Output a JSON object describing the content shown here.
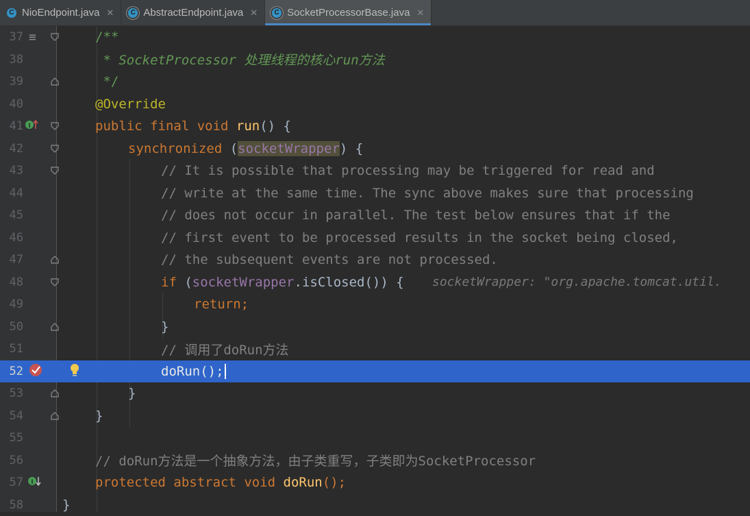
{
  "tabs": [
    {
      "label": "NioEndpoint.java",
      "icon": "class-icon",
      "active": false
    },
    {
      "label": "AbstractEndpoint.java",
      "icon": "abstract-class-icon",
      "active": false
    },
    {
      "label": "SocketProcessorBase.java",
      "icon": "abstract-class-icon",
      "active": true
    }
  ],
  "close_glyph": "✕",
  "class_glyph": "C",
  "lines": {
    "l37": {
      "num": "37",
      "c1": "/**"
    },
    "l38": {
      "num": "38",
      "c1": " * SocketProcessor 处理线程的核心run方法"
    },
    "l39": {
      "num": "39",
      "c1": " */"
    },
    "l40": {
      "num": "40",
      "c1": "@Override"
    },
    "l41": {
      "num": "41",
      "kw": "public final void ",
      "fn": "run",
      "rest": "() {"
    },
    "l42": {
      "num": "42",
      "kw": "synchronized ",
      "p1": "(",
      "fld": "socketWrapper",
      "p2": ") {"
    },
    "l43": {
      "num": "43",
      "c1": "// It is possible that processing may be triggered for read and"
    },
    "l44": {
      "num": "44",
      "c1": "// write at the same time. The sync above makes sure that processing"
    },
    "l45": {
      "num": "45",
      "c1": "// does not occur in parallel. The test below ensures that if the"
    },
    "l46": {
      "num": "46",
      "c1": "// first event to be processed results in the socket being closed,"
    },
    "l47": {
      "num": "47",
      "c1": "// the subsequent events are not processed."
    },
    "l48": {
      "num": "48",
      "kw": "if ",
      "p1": "(",
      "fld": "socketWrapper",
      "rest": ".isClosed()) {",
      "hint": "socketWrapper: \"org.apache.tomcat.util."
    },
    "l49": {
      "num": "49",
      "kw": "return;"
    },
    "l50": {
      "num": "50",
      "c1": "}"
    },
    "l51": {
      "num": "51",
      "c1": "// 调用了doRun方法"
    },
    "l52": {
      "num": "52",
      "c1": "doRun();"
    },
    "l53": {
      "num": "53",
      "c1": "}"
    },
    "l54": {
      "num": "54",
      "c1": "}"
    },
    "l55": {
      "num": "55",
      "c1": ""
    },
    "l56": {
      "num": "56",
      "c1": "// doRun方法是一个抽象方法，由子类重写，子类即为SocketProcessor"
    },
    "l57": {
      "num": "57",
      "kw": "protected abstract void ",
      "fn": "doRun",
      "rest": "();"
    },
    "l58": {
      "num": "58",
      "c1": "}"
    }
  },
  "gutter_glyphs": {
    "structure": "≡",
    "implements_up": "⬆",
    "implements_down": "⬇",
    "bulb": "💡"
  },
  "colors": {
    "background": "#2b2b2b",
    "selection": "#2f65ca",
    "keyword": "#cc7832",
    "comment": "#808080",
    "doc_comment": "#629755",
    "annotation": "#bbb529",
    "method": "#ffc66d",
    "field": "#9876aa"
  }
}
